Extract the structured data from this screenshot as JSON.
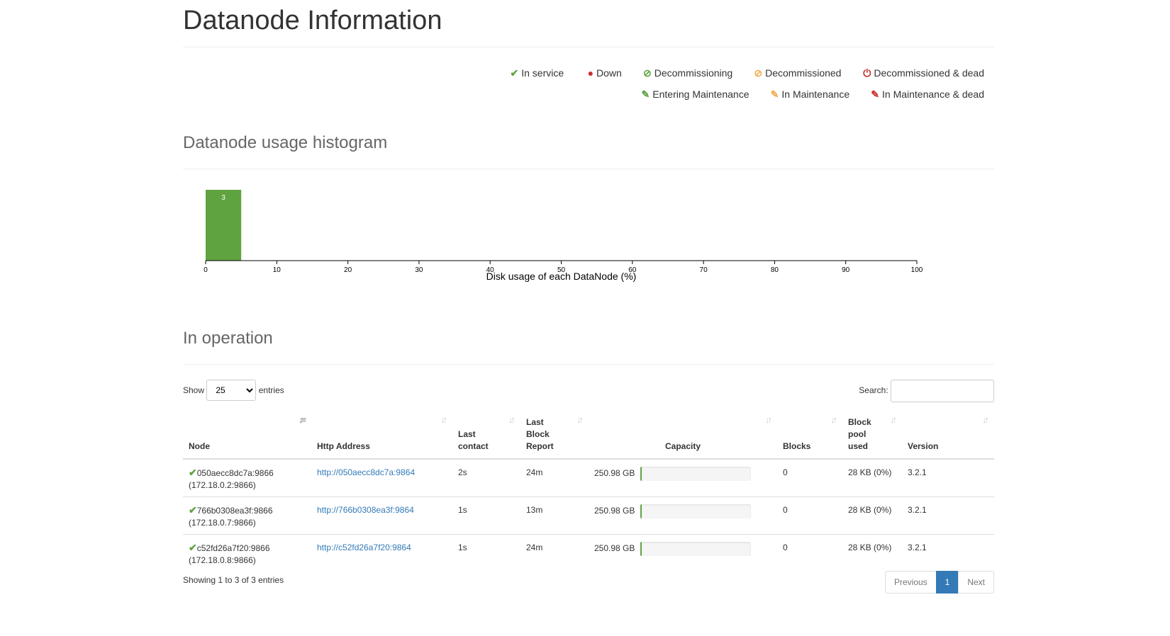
{
  "page_title": "Datanode Information",
  "legend": [
    {
      "icon": "check-icon",
      "glyph": "✔",
      "color": "#5fa341",
      "label": "In service"
    },
    {
      "icon": "exclamation-circle-icon",
      "glyph": "●",
      "color": "#c9302c",
      "label": "Down"
    },
    {
      "icon": "ban-icon",
      "glyph": "⊘",
      "color": "#5fa341",
      "label": "Decommissioning"
    },
    {
      "icon": "ban-icon",
      "glyph": "⊘",
      "color": "#f0ad4e",
      "label": "Decommissioned"
    },
    {
      "icon": "power-off-icon",
      "glyph": "⏻",
      "color": "#c9302c",
      "label": "Decommissioned & dead"
    },
    {
      "icon": "wrench-icon",
      "glyph": "🔧",
      "color": "#5fa341",
      "label": "Entering Maintenance"
    },
    {
      "icon": "wrench-icon",
      "glyph": "🔧",
      "color": "#f0ad4e",
      "label": "In Maintenance"
    },
    {
      "icon": "wrench-icon",
      "glyph": "🔧",
      "color": "#c9302c",
      "label": "In Maintenance & dead"
    }
  ],
  "histogram_title": "Datanode usage histogram",
  "chart_data": {
    "type": "bar",
    "bins": [
      [
        0,
        5
      ]
    ],
    "values": [
      3
    ],
    "data_labels": [
      "3"
    ],
    "xlim": [
      0,
      100
    ],
    "xticks": [
      "0",
      "10",
      "20",
      "30",
      "40",
      "50",
      "60",
      "70",
      "80",
      "90",
      "100"
    ],
    "xlabel": "Disk usage of each DataNode (%)",
    "color": "#5fa341"
  },
  "operation_title": "In operation",
  "controls": {
    "show_label": "Show",
    "entries_label": "entries",
    "page_size": "25",
    "search_label": "Search:"
  },
  "table": {
    "headers": [
      "Node",
      "Http Address",
      "Last contact",
      "Last Block Report",
      "Capacity",
      "Blocks",
      "Block pool used",
      "Version"
    ],
    "rows": [
      {
        "node": "050aecc8dc7a:9866",
        "ip": "(172.18.0.2:9866)",
        "http": "http://050aecc8dc7a:9864",
        "contact": "2s",
        "report": "24m",
        "capacity": "250.98 GB",
        "usage": 0,
        "blocks": "0",
        "pool": "28 KB (0%)",
        "version": "3.2.1"
      },
      {
        "node": "766b0308ea3f:9866",
        "ip": "(172.18.0.7:9866)",
        "http": "http://766b0308ea3f:9864",
        "contact": "1s",
        "report": "13m",
        "capacity": "250.98 GB",
        "usage": 0,
        "blocks": "0",
        "pool": "28 KB (0%)",
        "version": "3.2.1"
      },
      {
        "node": "c52fd26a7f20:9866",
        "ip": "(172.18.0.8:9866)",
        "http": "http://c52fd26a7f20:9864",
        "contact": "1s",
        "report": "24m",
        "capacity": "250.98 GB",
        "usage": 0,
        "blocks": "0",
        "pool": "28 KB (0%)",
        "version": "3.2.1"
      }
    ]
  },
  "footer": {
    "info": "Showing 1 to 3 of 3 entries",
    "previous": "Previous",
    "page": "1",
    "next": "Next"
  }
}
